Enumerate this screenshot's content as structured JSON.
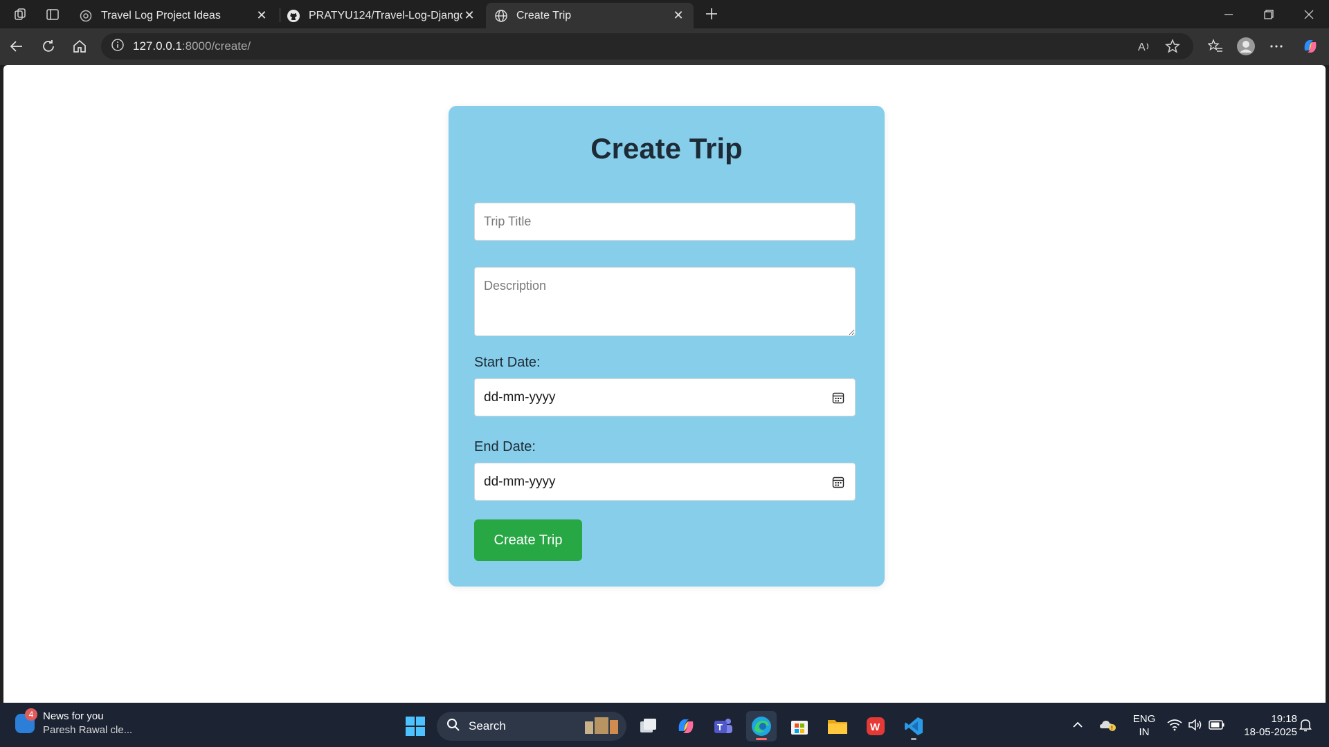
{
  "browser": {
    "tabs": [
      {
        "label": "Travel Log Project Ideas",
        "active": false
      },
      {
        "label": "PRATYU124/Travel-Log-Django",
        "active": false
      },
      {
        "label": "Create Trip",
        "active": true
      }
    ],
    "address": {
      "host": "127.0.0.1",
      "path": ":8000/create/"
    }
  },
  "page": {
    "title": "Create Trip",
    "trip_title_placeholder": "Trip Title",
    "description_placeholder": "Description",
    "start_date_label": "Start Date:",
    "start_date_value": "dd-mm-yyyy",
    "end_date_label": "End Date:",
    "end_date_value": "dd-mm-yyyy",
    "submit_label": "Create Trip",
    "card_color": "#87ceeb",
    "button_color": "#28a745"
  },
  "taskbar": {
    "news_badge": "4",
    "news_title": "News for you",
    "news_subtitle": "Paresh Rawal cle...",
    "search_label": "Search",
    "lang_line1": "ENG",
    "lang_line2": "IN",
    "time": "19:18",
    "date": "18-05-2025"
  }
}
